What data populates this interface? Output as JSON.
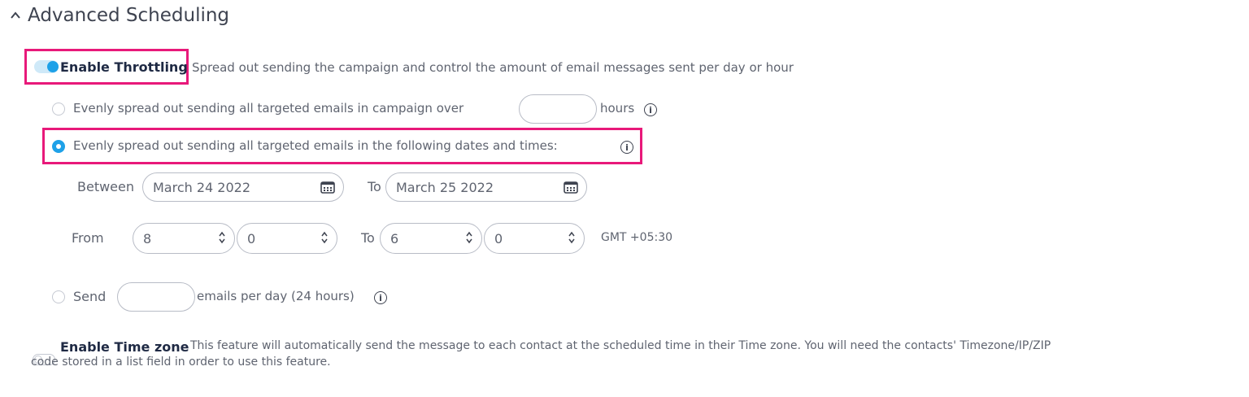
{
  "section": {
    "title": "Advanced Scheduling"
  },
  "throttling": {
    "toggle_label": "Enable Throttling",
    "description": "Spread out sending the campaign and control the amount of email messages sent per day or hour",
    "option_hours": {
      "label": "Evenly spread out sending all targeted emails in campaign over",
      "value": "",
      "suffix": "hours"
    },
    "option_dates": {
      "label": "Evenly spread out sending all targeted emails in the following dates and times:"
    },
    "between_label": "Between",
    "between_date": "March 24 2022",
    "to_label": "To",
    "to_date": "March 25 2022",
    "from_label": "From",
    "from_hour": "8",
    "from_minute": "0",
    "to_time_label": "To",
    "to_hour": "6",
    "to_minute": "0",
    "timezone": "GMT +05:30",
    "option_send": {
      "label": "Send",
      "value": "",
      "suffix": "emails per day (24 hours)"
    }
  },
  "timezone_feature": {
    "toggle_label": "Enable Time zone",
    "description_line1": "This feature will automatically send the message to each contact at the scheduled time in their Time zone. You will need the contacts' Timezone/IP/ZIP",
    "description_line2": "code stored in a list field in order to use this feature."
  },
  "colors": {
    "accent": "#1ea1e8",
    "highlight": "#e8197a",
    "text": "#5f6470",
    "heading": "#1f2a44"
  },
  "icons": [
    "chevron-up-icon",
    "info-icon",
    "calendar-icon",
    "spinner-icon"
  ]
}
